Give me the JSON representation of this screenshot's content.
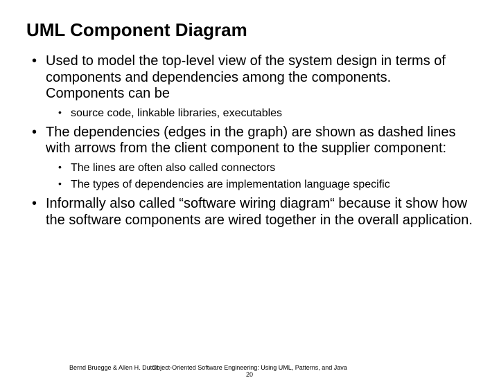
{
  "title": "UML Component Diagram",
  "bullets": {
    "b1": "Used to model the top-level view of the system design in terms of components and dependencies among the components. Components can be",
    "b1_sub1": "source code, linkable libraries, executables",
    "b2": "The dependencies (edges in the graph) are shown as dashed lines with arrows from the client component to the supplier component:",
    "b2_sub1": "The lines are often also called connectors",
    "b2_sub2": "The types of dependencies are implementation language specific",
    "b3": "Informally also called “software wiring diagram“ because it show how the software components are wired together in the overall application."
  },
  "footer": {
    "authors": "Bernd Bruegge & Allen H. Dutoit",
    "book": "Object-Oriented Software Engineering: Using UML, Patterns, and Java",
    "page": "20"
  }
}
